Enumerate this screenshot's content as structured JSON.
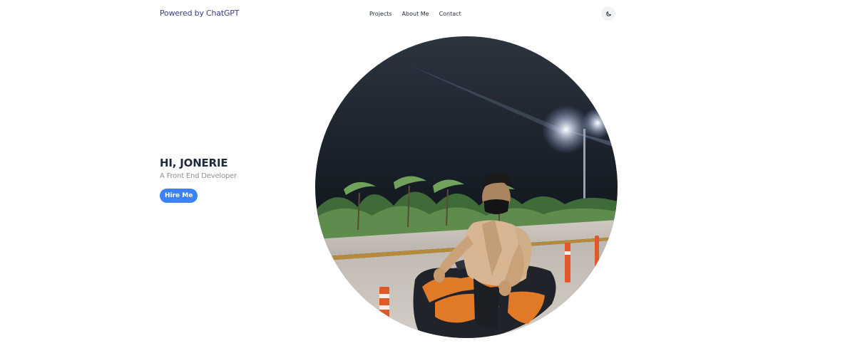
{
  "header": {
    "brand": "Powered by ChatGPT",
    "nav": [
      "Projects",
      "About Me",
      "Contact"
    ],
    "theme_toggle_icon": "moon-icon"
  },
  "hero": {
    "title": "HI, JONERIE",
    "subtitle": "A Front End Developer",
    "cta_label": "Hire Me"
  },
  "profile_photo": {
    "subject": "person in face mask riding an orange scooter at night by a road with palm trees and a street lamp"
  },
  "colors": {
    "brand_text": "#3b3b8c",
    "accent": "#3b82f6",
    "title": "#1e2a3b",
    "subtitle": "#8a8f98"
  }
}
